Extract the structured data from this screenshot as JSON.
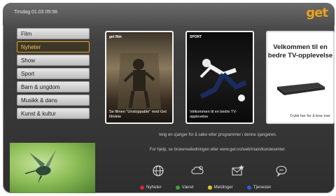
{
  "header": {
    "datetime": "Tirsdag 01.03 09:56",
    "brand": "get"
  },
  "menu": {
    "items": [
      {
        "label": "Film",
        "active": false
      },
      {
        "label": "Nyheter",
        "active": true
      },
      {
        "label": "Show",
        "active": false
      },
      {
        "label": "Sport",
        "active": false
      },
      {
        "label": "Barn & ungdom",
        "active": false
      },
      {
        "label": "Musikk & dans",
        "active": false
      },
      {
        "label": "Kunst & kultur",
        "active": false
      }
    ]
  },
  "promos": [
    {
      "badge": "get film",
      "caption": "Se filmen \"Unstoppable\" med Get filmleie"
    },
    {
      "badge": "SPORT",
      "caption": "Velkommen til en bedre TV-opplevelse"
    },
    {
      "title": "Velkommen til en bedre TV-opplevelse",
      "caption": "Trykk her for å lese mer"
    }
  ],
  "hints": {
    "line1": "Velg en sjanger for å søke etter programmer i denne sjangeren.",
    "line2": "For hjelp, se brukerveiledningen eller  www.get.no/web/main/kundesenter."
  },
  "icons": [
    "globe-icon",
    "weather-icon",
    "messages-icon",
    "chat-icon"
  ],
  "legend": [
    {
      "label": "Nyheter",
      "color": "#d8262b"
    },
    {
      "label": "Været",
      "color": "#3aa13a"
    },
    {
      "label": "Meldinger",
      "color": "#e6c22a"
    },
    {
      "label": "Tjenester",
      "color": "#2f5fcf"
    }
  ]
}
